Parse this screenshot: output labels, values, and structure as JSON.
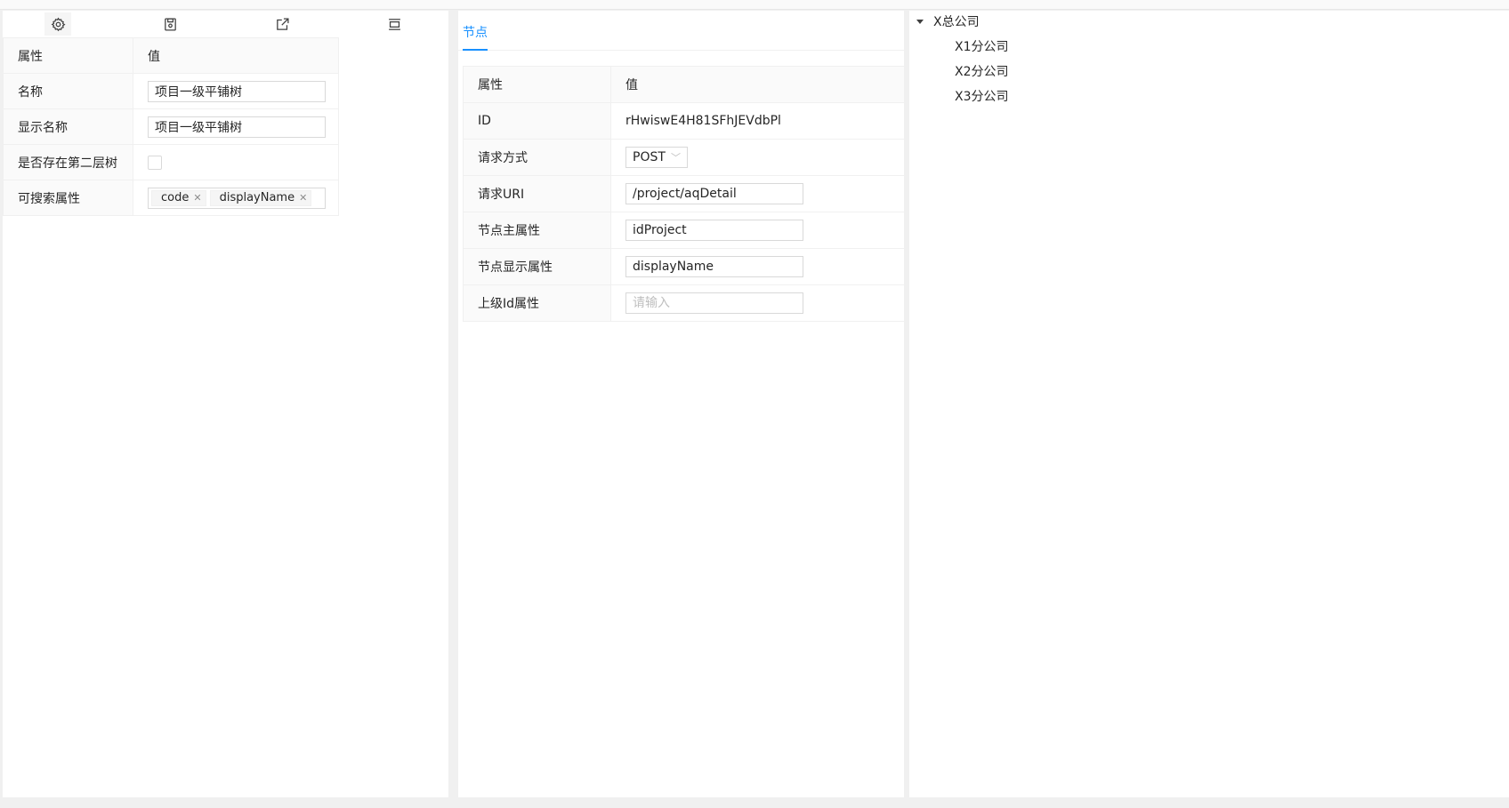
{
  "toolbar": {
    "icons": [
      "gear-icon",
      "save-icon",
      "export-icon",
      "layout-icon"
    ]
  },
  "left_table": {
    "header": {
      "prop": "属性",
      "value": "值"
    },
    "rows": {
      "name": {
        "label": "名称",
        "value": "项目一级平铺树"
      },
      "display_name": {
        "label": "显示名称",
        "value": "项目一级平铺树"
      },
      "second_tree": {
        "label": "是否存在第二层树",
        "checked": false
      },
      "searchable": {
        "label": "可搜索属性",
        "tags": [
          "code",
          "displayName"
        ]
      }
    }
  },
  "mid": {
    "tab": "节点",
    "header": {
      "prop": "属性",
      "value": "值"
    },
    "rows": {
      "id": {
        "label": "ID",
        "value": "rHwiswE4H81SFhJEVdbPl"
      },
      "method": {
        "label": "请求方式",
        "value": "POST"
      },
      "uri": {
        "label": "请求URI",
        "value": "/project/aqDetail"
      },
      "primary": {
        "label": "节点主属性",
        "value": "idProject"
      },
      "display": {
        "label": "节点显示属性",
        "value": "displayName"
      },
      "parent": {
        "label": "上级Id属性",
        "value": "",
        "placeholder": "请输入"
      }
    }
  },
  "tree": {
    "root": "X总公司",
    "children": [
      "X1分公司",
      "X2分公司",
      "X3分公司"
    ]
  },
  "colors": {
    "accent": "#1890ff"
  }
}
